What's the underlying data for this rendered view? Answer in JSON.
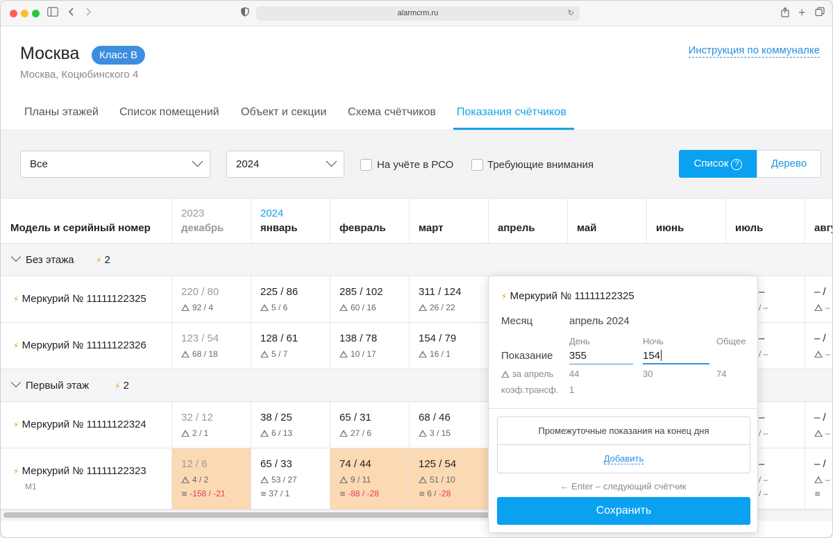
{
  "browser": {
    "url": "alarmcrm.ru"
  },
  "header": {
    "title": "Москва",
    "badge": "Класс В",
    "subtitle": "Москва, Коцюбинского 4",
    "instruction_link": "Инструкция по коммуналке"
  },
  "tabs": [
    {
      "label": "Планы этажей"
    },
    {
      "label": "Список помещений"
    },
    {
      "label": "Объект и секции"
    },
    {
      "label": "Схема счётчиков"
    },
    {
      "label": "Показания счётчиков",
      "active": true
    }
  ],
  "filters": {
    "type_select": "Все",
    "year_select": "2024",
    "checkbox_rso": "На учёте в РСО",
    "checkbox_attention": "Требующие внимания",
    "view_list": "Список",
    "view_list_icon": "?",
    "view_tree": "Дерево"
  },
  "table": {
    "first_header": "Модель и серийный номер",
    "columns": [
      {
        "year": "2023",
        "month": "декабрь"
      },
      {
        "year": "2024",
        "month": "январь"
      },
      {
        "year": "",
        "month": "февраль"
      },
      {
        "year": "",
        "month": "март"
      },
      {
        "year": "",
        "month": "апрель"
      },
      {
        "year": "",
        "month": "май"
      },
      {
        "year": "",
        "month": "июнь"
      },
      {
        "year": "",
        "month": "июль"
      },
      {
        "year": "",
        "month": "авгу"
      }
    ],
    "groups": [
      {
        "name": "Без этажа",
        "count": "2"
      },
      {
        "name": "Первый этаж",
        "count": "2"
      }
    ],
    "rows": [
      {
        "name": "Меркурий № 11111122325",
        "cells": [
          {
            "v": "220 / 80",
            "d": "92 / 4"
          },
          {
            "v": "225 / 86",
            "d": "5 / 6"
          },
          {
            "v": "285 / 102",
            "d": "60 / 16"
          },
          {
            "v": "311 / 124",
            "d": "26 / 22"
          }
        ]
      },
      {
        "name": "Меркурий № 11111122326",
        "cells": [
          {
            "v": "123 / 54",
            "d": "68 / 18"
          },
          {
            "v": "128 / 61",
            "d": "5 / 7"
          },
          {
            "v": "138 / 78",
            "d": "10 / 17"
          },
          {
            "v": "154 / 79",
            "d": "16 / 1"
          }
        ]
      },
      {
        "name": "Меркурий № 11111122324",
        "cells": [
          {
            "v": "32 / 12",
            "d": "2 / 1"
          },
          {
            "v": "38 / 25",
            "d": "6 / 13"
          },
          {
            "v": "65 / 31",
            "d": "27 / 6"
          },
          {
            "v": "68 / 46",
            "d": "3 / 15"
          }
        ]
      },
      {
        "name": "Меркурий № 11111122323",
        "sub": "М1",
        "cells": [
          {
            "v": "12 / 6",
            "d": "4 / 2",
            "e": "-158 / -21"
          },
          {
            "v": "65 / 33",
            "d": "53 / 27",
            "e": "37 / 1"
          },
          {
            "v": "74 / 44",
            "d": "9 / 11",
            "e": "-88 / -28"
          },
          {
            "v": "125 / 54",
            "d": "51 / 10",
            "e": "6 / -28"
          }
        ]
      }
    ],
    "dash_value": "–",
    "dash_short": "/ –",
    "dash_pair": "– /",
    "delta_dash": "–"
  },
  "popup": {
    "meter": "Меркурий № 11111122325",
    "month_label": "Месяц",
    "month_value": "апрель 2024",
    "reading_label": "Показание",
    "day_label": "День",
    "night_label": "Ночь",
    "total_label": "Общее",
    "day_value": "355",
    "night_value": "154",
    "for_april_label": "за апрель",
    "for_april_day": "44",
    "for_april_night": "30",
    "for_april_total": "74",
    "coef_label": "коэф.трансф.",
    "coef_value": "1",
    "intermediate_label": "Промежуточные показания на конец дня",
    "add_link": "Добавить",
    "hint": "← Enter – следующий счётчик",
    "save_button": "Сохранить"
  },
  "colors": {
    "accent": "#0aa1f0",
    "badge": "#3d8de0",
    "highlight": "#fbd9b3",
    "negative": "#e8375a"
  }
}
